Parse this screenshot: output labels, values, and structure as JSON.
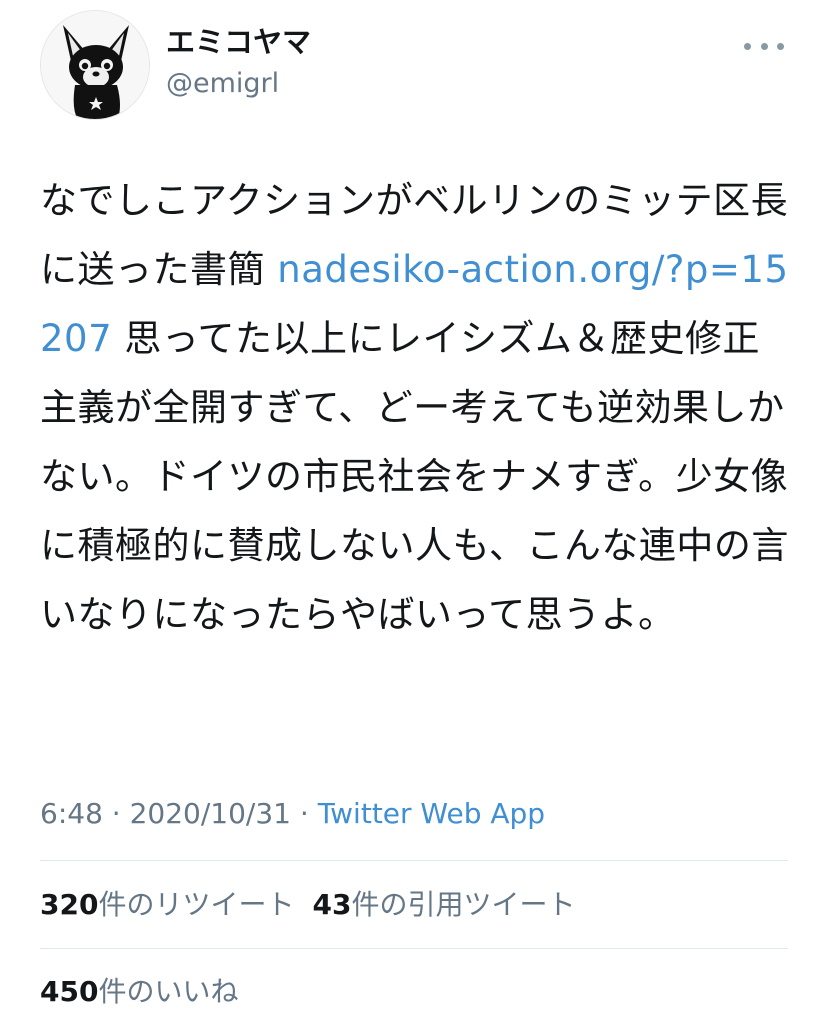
{
  "author": {
    "display_name": "エミコヤマ",
    "handle": "@emigrl",
    "avatar_icon": "chihuahua-avatar-icon"
  },
  "menu": {
    "icon": "more-horizontal-icon"
  },
  "tweet": {
    "text_before_link": "なでしこアクションがベルリンのミッテ区長に送った書簡 ",
    "link_text": "nadesiko-action.org/?p=15207",
    "text_after_link": " 思ってた以上にレイシズム＆歴史修正主義が全開すぎて、どー考えても逆効果しかない。ドイツの市民社会をナメすぎ。少女像に積極的に賛成しない人も、こんな連中の言いなりになったらやばいって思うよ。",
    "time": "6:48",
    "separator": " · ",
    "date": "2020/10/31",
    "source": "Twitter Web App"
  },
  "stats": {
    "retweets_count": "320",
    "retweets_label": "件のリツイート",
    "quotes_count": "43",
    "quotes_label": "件の引用ツイート",
    "likes_count": "450",
    "likes_label": "件のいいね"
  },
  "colors": {
    "link": "#3f8fd2",
    "secondary_text": "#657786",
    "primary_text": "#14171a",
    "divider": "#e1e8ed"
  }
}
